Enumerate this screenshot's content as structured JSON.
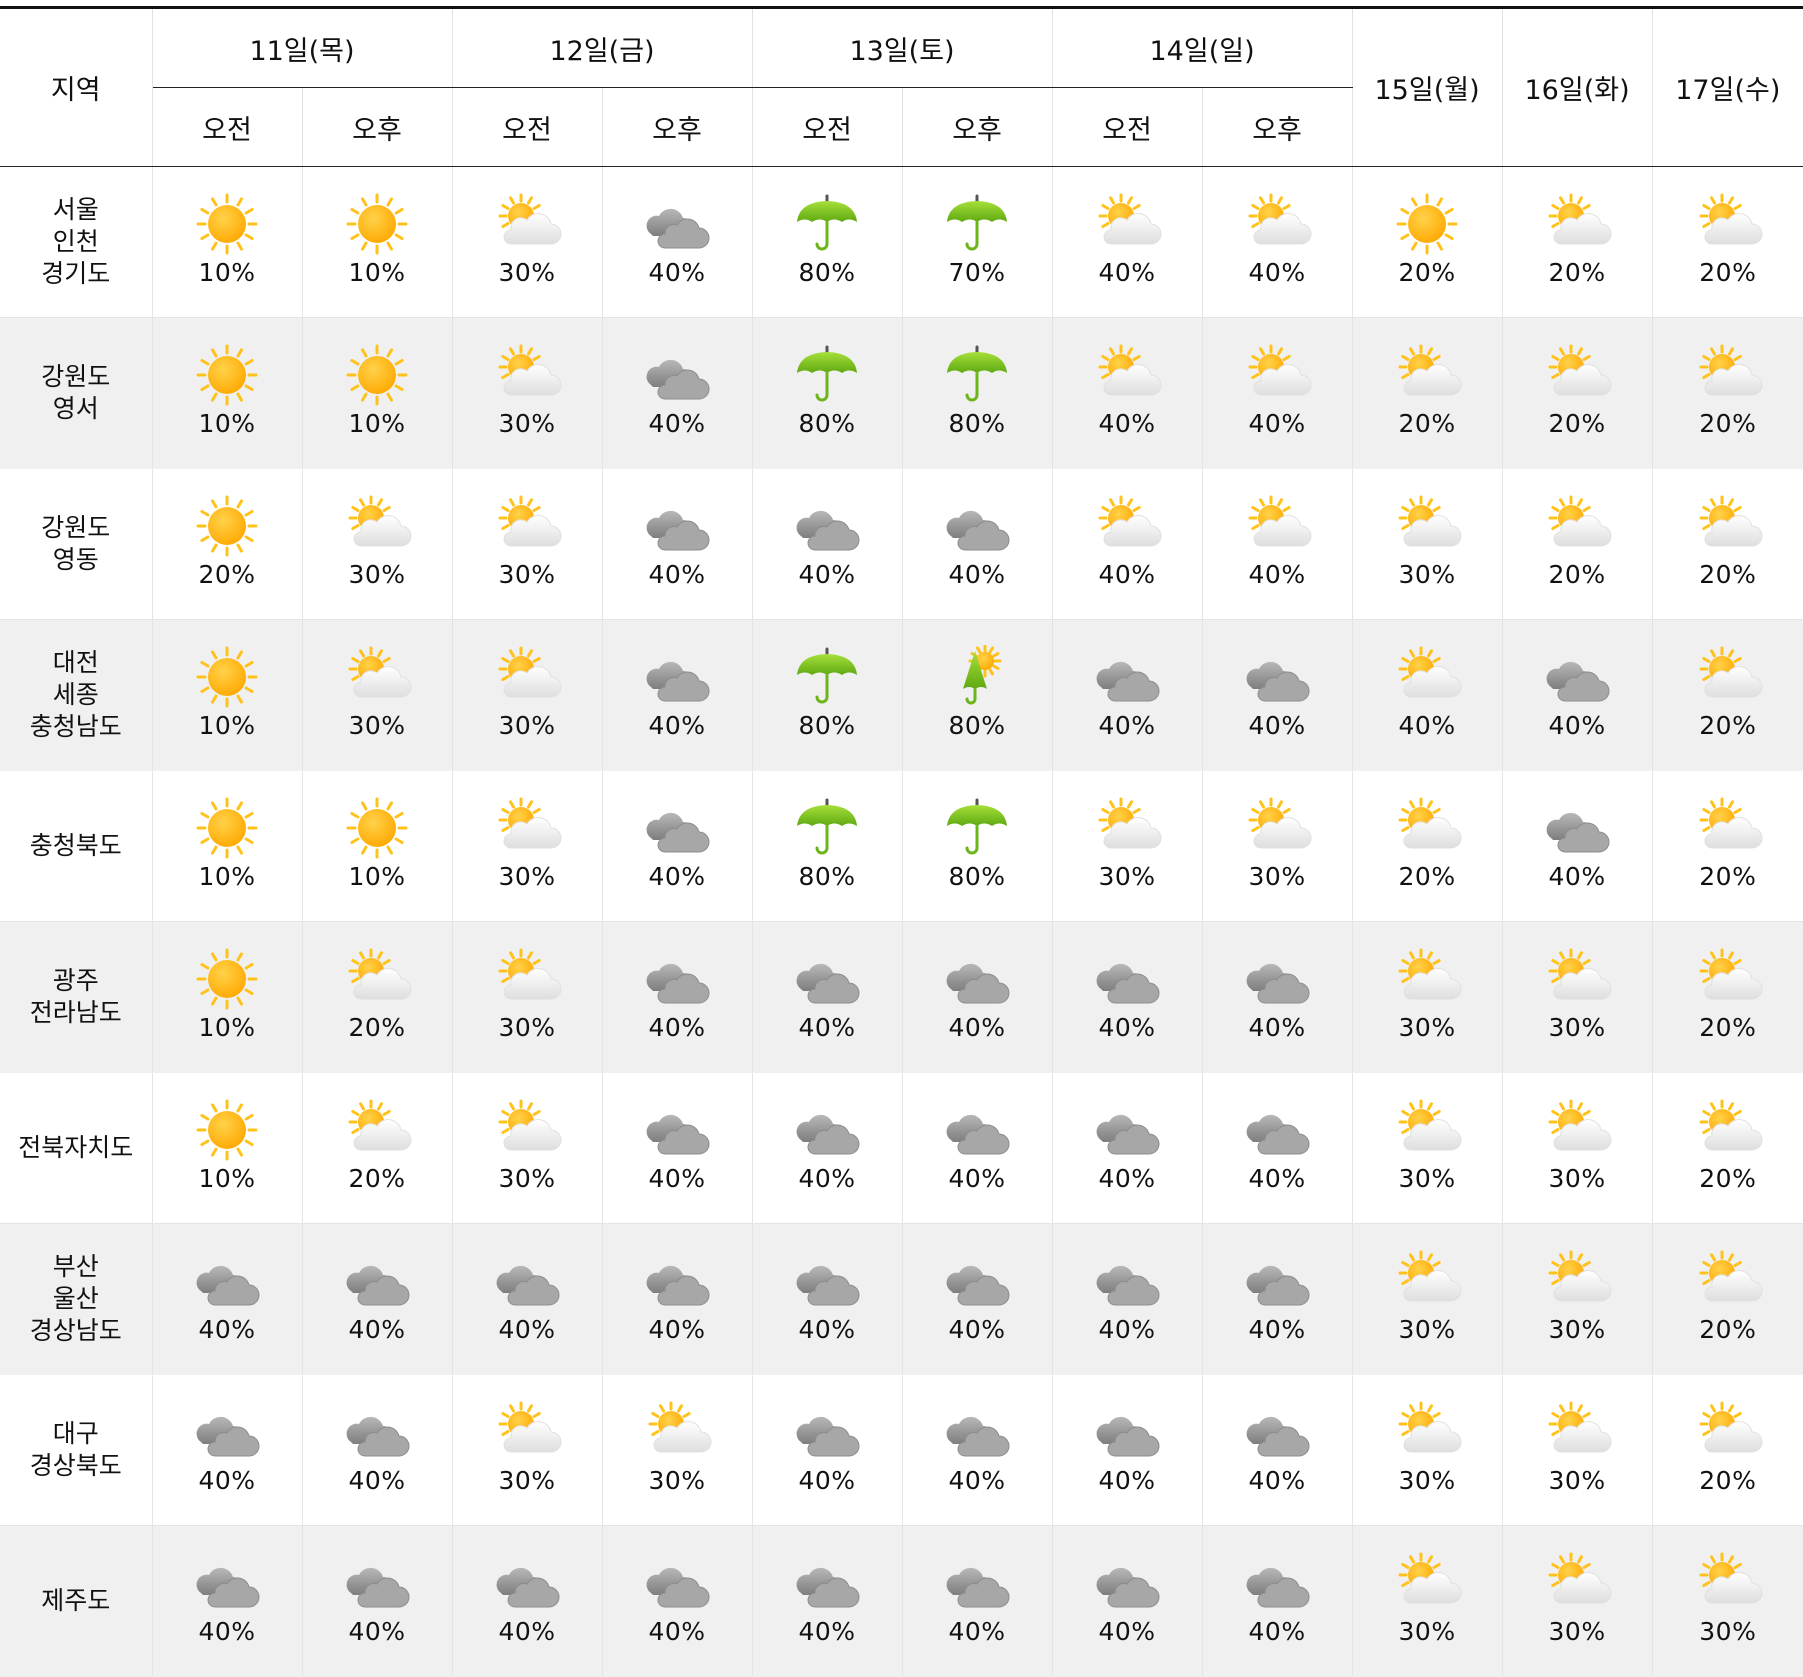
{
  "header": {
    "region_label": "지역",
    "split_days": [
      {
        "label": "11일(목)",
        "am": "오전",
        "pm": "오후"
      },
      {
        "label": "12일(금)",
        "am": "오전",
        "pm": "오후"
      },
      {
        "label": "13일(토)",
        "am": "오전",
        "pm": "오후"
      },
      {
        "label": "14일(일)",
        "am": "오전",
        "pm": "오후"
      }
    ],
    "single_days": [
      "15일(월)",
      "16일(화)",
      "17일(수)"
    ]
  },
  "icons": {
    "S": "sunny-icon",
    "P": "partly-cloudy-icon",
    "C": "cloudy-icon",
    "R": "rain-umbrella-icon",
    "RS": "shower-umbrella-sun-icon"
  },
  "colors": {
    "sun_core": "#ffa800",
    "sun_ray": "#ffc21a",
    "cloud_dark": "#9a9a9a",
    "cloud_light": "#f2f2f2",
    "umbrella": "#7ac41a",
    "row_alt": "#f0f0f0"
  },
  "rows": [
    {
      "region": [
        "서울",
        "인천",
        "경기도"
      ],
      "cells": [
        {
          "icon": "S",
          "pct": "10%"
        },
        {
          "icon": "S",
          "pct": "10%"
        },
        {
          "icon": "P",
          "pct": "30%"
        },
        {
          "icon": "C",
          "pct": "40%"
        },
        {
          "icon": "R",
          "pct": "80%"
        },
        {
          "icon": "R",
          "pct": "70%"
        },
        {
          "icon": "P",
          "pct": "40%"
        },
        {
          "icon": "P",
          "pct": "40%"
        },
        {
          "icon": "S",
          "pct": "20%"
        },
        {
          "icon": "P",
          "pct": "20%"
        },
        {
          "icon": "P",
          "pct": "20%"
        }
      ]
    },
    {
      "region": [
        "강원도",
        "영서"
      ],
      "cells": [
        {
          "icon": "S",
          "pct": "10%"
        },
        {
          "icon": "S",
          "pct": "10%"
        },
        {
          "icon": "P",
          "pct": "30%"
        },
        {
          "icon": "C",
          "pct": "40%"
        },
        {
          "icon": "R",
          "pct": "80%"
        },
        {
          "icon": "R",
          "pct": "80%"
        },
        {
          "icon": "P",
          "pct": "40%"
        },
        {
          "icon": "P",
          "pct": "40%"
        },
        {
          "icon": "P",
          "pct": "20%"
        },
        {
          "icon": "P",
          "pct": "20%"
        },
        {
          "icon": "P",
          "pct": "20%"
        }
      ]
    },
    {
      "region": [
        "강원도",
        "영동"
      ],
      "cells": [
        {
          "icon": "S",
          "pct": "20%"
        },
        {
          "icon": "P",
          "pct": "30%"
        },
        {
          "icon": "P",
          "pct": "30%"
        },
        {
          "icon": "C",
          "pct": "40%"
        },
        {
          "icon": "C",
          "pct": "40%"
        },
        {
          "icon": "C",
          "pct": "40%"
        },
        {
          "icon": "P",
          "pct": "40%"
        },
        {
          "icon": "P",
          "pct": "40%"
        },
        {
          "icon": "P",
          "pct": "30%"
        },
        {
          "icon": "P",
          "pct": "20%"
        },
        {
          "icon": "P",
          "pct": "20%"
        }
      ]
    },
    {
      "region": [
        "대전",
        "세종",
        "충청남도"
      ],
      "cells": [
        {
          "icon": "S",
          "pct": "10%"
        },
        {
          "icon": "P",
          "pct": "30%"
        },
        {
          "icon": "P",
          "pct": "30%"
        },
        {
          "icon": "C",
          "pct": "40%"
        },
        {
          "icon": "R",
          "pct": "80%"
        },
        {
          "icon": "RS",
          "pct": "80%"
        },
        {
          "icon": "C",
          "pct": "40%"
        },
        {
          "icon": "C",
          "pct": "40%"
        },
        {
          "icon": "P",
          "pct": "40%"
        },
        {
          "icon": "C",
          "pct": "40%"
        },
        {
          "icon": "P",
          "pct": "20%"
        }
      ]
    },
    {
      "region": [
        "충청북도"
      ],
      "cells": [
        {
          "icon": "S",
          "pct": "10%"
        },
        {
          "icon": "S",
          "pct": "10%"
        },
        {
          "icon": "P",
          "pct": "30%"
        },
        {
          "icon": "C",
          "pct": "40%"
        },
        {
          "icon": "R",
          "pct": "80%"
        },
        {
          "icon": "R",
          "pct": "80%"
        },
        {
          "icon": "P",
          "pct": "30%"
        },
        {
          "icon": "P",
          "pct": "30%"
        },
        {
          "icon": "P",
          "pct": "20%"
        },
        {
          "icon": "C",
          "pct": "40%"
        },
        {
          "icon": "P",
          "pct": "20%"
        }
      ]
    },
    {
      "region": [
        "광주",
        "전라남도"
      ],
      "cells": [
        {
          "icon": "S",
          "pct": "10%"
        },
        {
          "icon": "P",
          "pct": "20%"
        },
        {
          "icon": "P",
          "pct": "30%"
        },
        {
          "icon": "C",
          "pct": "40%"
        },
        {
          "icon": "C",
          "pct": "40%"
        },
        {
          "icon": "C",
          "pct": "40%"
        },
        {
          "icon": "C",
          "pct": "40%"
        },
        {
          "icon": "C",
          "pct": "40%"
        },
        {
          "icon": "P",
          "pct": "30%"
        },
        {
          "icon": "P",
          "pct": "30%"
        },
        {
          "icon": "P",
          "pct": "20%"
        }
      ]
    },
    {
      "region": [
        "전북자치도"
      ],
      "cells": [
        {
          "icon": "S",
          "pct": "10%"
        },
        {
          "icon": "P",
          "pct": "20%"
        },
        {
          "icon": "P",
          "pct": "30%"
        },
        {
          "icon": "C",
          "pct": "40%"
        },
        {
          "icon": "C",
          "pct": "40%"
        },
        {
          "icon": "C",
          "pct": "40%"
        },
        {
          "icon": "C",
          "pct": "40%"
        },
        {
          "icon": "C",
          "pct": "40%"
        },
        {
          "icon": "P",
          "pct": "30%"
        },
        {
          "icon": "P",
          "pct": "30%"
        },
        {
          "icon": "P",
          "pct": "20%"
        }
      ]
    },
    {
      "region": [
        "부산",
        "울산",
        "경상남도"
      ],
      "cells": [
        {
          "icon": "C",
          "pct": "40%"
        },
        {
          "icon": "C",
          "pct": "40%"
        },
        {
          "icon": "C",
          "pct": "40%"
        },
        {
          "icon": "C",
          "pct": "40%"
        },
        {
          "icon": "C",
          "pct": "40%"
        },
        {
          "icon": "C",
          "pct": "40%"
        },
        {
          "icon": "C",
          "pct": "40%"
        },
        {
          "icon": "C",
          "pct": "40%"
        },
        {
          "icon": "P",
          "pct": "30%"
        },
        {
          "icon": "P",
          "pct": "30%"
        },
        {
          "icon": "P",
          "pct": "20%"
        }
      ]
    },
    {
      "region": [
        "대구",
        "경상북도"
      ],
      "cells": [
        {
          "icon": "C",
          "pct": "40%"
        },
        {
          "icon": "C",
          "pct": "40%"
        },
        {
          "icon": "P",
          "pct": "30%"
        },
        {
          "icon": "P",
          "pct": "30%"
        },
        {
          "icon": "C",
          "pct": "40%"
        },
        {
          "icon": "C",
          "pct": "40%"
        },
        {
          "icon": "C",
          "pct": "40%"
        },
        {
          "icon": "C",
          "pct": "40%"
        },
        {
          "icon": "P",
          "pct": "30%"
        },
        {
          "icon": "P",
          "pct": "30%"
        },
        {
          "icon": "P",
          "pct": "20%"
        }
      ]
    },
    {
      "region": [
        "제주도"
      ],
      "cells": [
        {
          "icon": "C",
          "pct": "40%"
        },
        {
          "icon": "C",
          "pct": "40%"
        },
        {
          "icon": "C",
          "pct": "40%"
        },
        {
          "icon": "C",
          "pct": "40%"
        },
        {
          "icon": "C",
          "pct": "40%"
        },
        {
          "icon": "C",
          "pct": "40%"
        },
        {
          "icon": "C",
          "pct": "40%"
        },
        {
          "icon": "C",
          "pct": "40%"
        },
        {
          "icon": "P",
          "pct": "30%"
        },
        {
          "icon": "P",
          "pct": "30%"
        },
        {
          "icon": "P",
          "pct": "30%"
        }
      ]
    }
  ]
}
